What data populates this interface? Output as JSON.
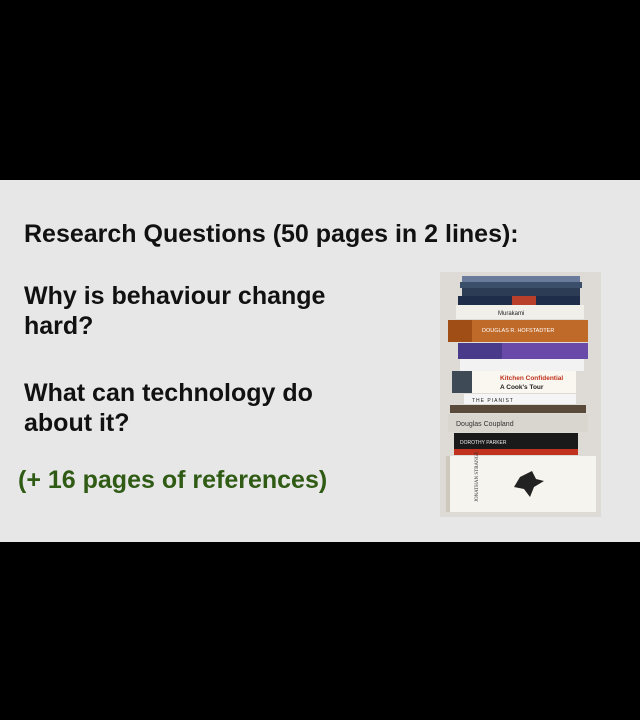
{
  "slide": {
    "heading": "Research Questions (50 pages in 2 lines):",
    "question1": "Why is behaviour change hard?",
    "question2": "What can technology do about it?",
    "references": "(+ 16 pages of references)"
  },
  "book_spines": {
    "murakami": "Murakami",
    "hofstadter": "DOUGLAS R. HOFSTADTER",
    "kitchen": "Kitchen Confidential",
    "kitchen2": "A Cook's Tour",
    "pianist": "THE PIANIST",
    "coupland": "Douglas Coupland",
    "parker": "DOROTHY PARKER",
    "jonathan": "JONATHAN STRANGE"
  },
  "colors": {
    "background": "#000000",
    "slide": "#e7e7e7",
    "text": "#111111",
    "accent_green": "#2f5b15"
  }
}
